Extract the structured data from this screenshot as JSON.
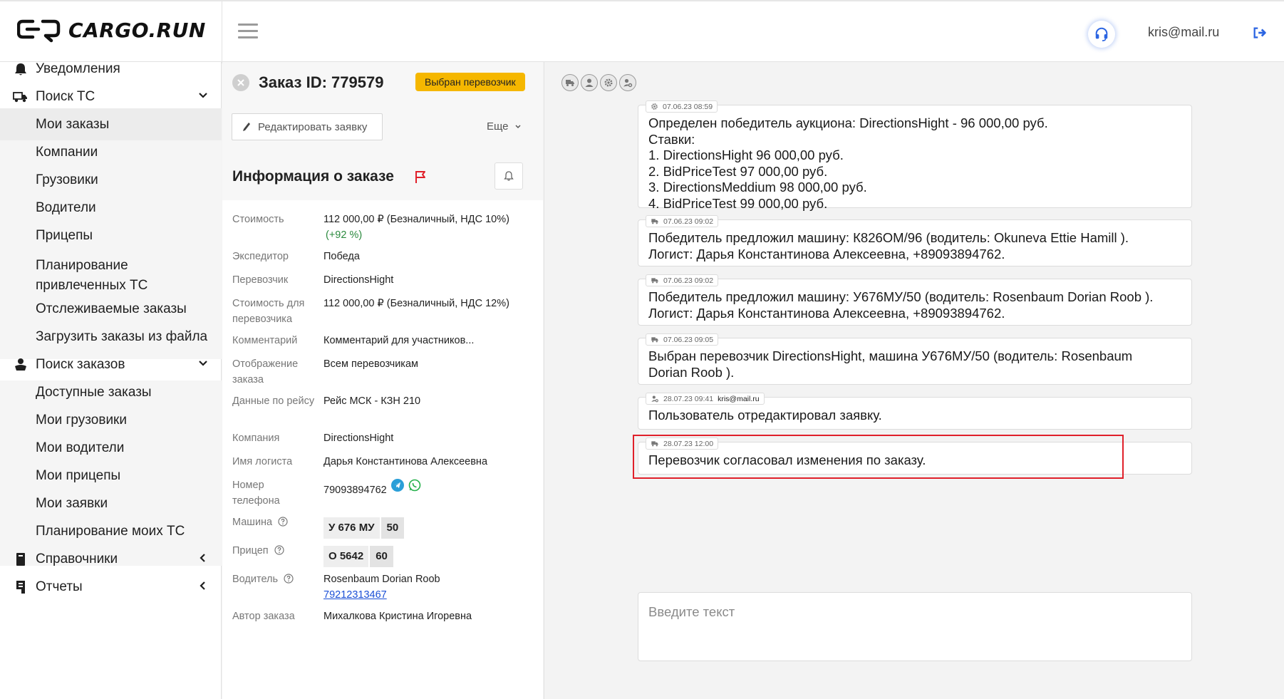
{
  "app": {
    "logo_text": "CARGO.RUN",
    "user_email": "kris@mail.ru"
  },
  "sidebar": {
    "items": [
      {
        "label": "Уведомления",
        "icon": "bell-icon"
      },
      {
        "label": "Поиск ТС",
        "icon": "truck-search-icon",
        "expanded": true
      },
      {
        "label": "Мои заказы",
        "active": true
      },
      {
        "label": "Компании"
      },
      {
        "label": "Грузовики"
      },
      {
        "label": "Водители"
      },
      {
        "label": "Прицепы"
      },
      {
        "label": "Планирование привлеченных ТС"
      },
      {
        "label": "Отслеживаемые заказы"
      },
      {
        "label": "Загрузить заказы из файла"
      },
      {
        "label": "Поиск заказов",
        "icon": "box-hand-icon",
        "expanded": true
      },
      {
        "label": "Доступные заказы"
      },
      {
        "label": "Мои грузовики"
      },
      {
        "label": "Мои водители"
      },
      {
        "label": "Мои прицепы"
      },
      {
        "label": "Мои заявки"
      },
      {
        "label": "Планирование моих ТС"
      },
      {
        "label": "Справочники",
        "icon": "book-icon",
        "expanded": false
      },
      {
        "label": "Отчеты",
        "icon": "report-icon",
        "expanded": false
      }
    ]
  },
  "order": {
    "title": "Заказ ID: 779579",
    "status": "Выбран перевозчик",
    "edit_label": "Редактировать заявку",
    "more_label": "Еще",
    "info_title": "Информация о заказе",
    "fields": {
      "cost_label": "Стоимость",
      "cost_value": "112 000,00 ₽ (Безналичный, НДС 10%)",
      "cost_delta": "(+92 %)",
      "forwarder_label": "Экспедитор",
      "forwarder_value": "Победа",
      "carrier_label": "Перевозчик",
      "carrier_value": "DirectionsHight",
      "carrier_cost_label": "Стоимость для перевозчика",
      "carrier_cost_value": "112 000,00 ₽ (Безналичный, НДС 12%)",
      "comment_label": "Комментарий",
      "comment_value": "Комментарий для участников...",
      "display_label": "Отображение заказа",
      "display_value": "Всем перевозчикам",
      "trip_label": "Данные по рейсу",
      "trip_value": "Рейс МСК - КЗН 210",
      "company_label": "Компания",
      "company_value": "DirectionsHight",
      "logist_label": "Имя логиста",
      "logist_value": "Дарья Константинова Алексеевна",
      "phone_label": "Номер телефона",
      "phone_value": "79093894762",
      "truck_label": "Машина",
      "truck_number": "У 676 МУ",
      "truck_region": "50",
      "trailer_label": "Прицеп",
      "trailer_number": "О 5642",
      "trailer_region": "60",
      "driver_label": "Водитель",
      "driver_name": "Rosenbaum Dorian Roob",
      "driver_phone": "79212313467",
      "author_label": "Автор заказа",
      "author_value": "Михалкова Кристина Игоревна"
    }
  },
  "feed": {
    "messages": [
      {
        "icon": "gear-icon",
        "time": "07.06.23 08:59",
        "author": "",
        "text": "Определен победитель аукциона: DirectionsHight - 96 000,00 руб.\nСтавки:\n1. DirectionsHight 96 000,00 руб.\n2. BidPriceTest 97 000,00 руб.\n3. DirectionsMeddium 98 000,00 руб.\n4. BidPriceTest 99 000,00 руб."
      },
      {
        "icon": "truck-icon",
        "time": "07.06.23 09:02",
        "author": "",
        "text": "Победитель предложил машину: К826ОМ/96 (водитель:  Okuneva Ettie Hamill ).\nЛогист: Дарья Константинова Алексеевна, +89093894762."
      },
      {
        "icon": "truck-icon",
        "time": "07.06.23 09:02",
        "author": "",
        "text": "Победитель предложил машину: У676МУ/50 (водитель:  Rosenbaum Dorian Roob ).\nЛогист: Дарья Константинова Алексеевна, +89093894762."
      },
      {
        "icon": "truck-icon",
        "time": "07.06.23 09:05",
        "author": "",
        "text": "Выбран перевозчик DirectionsHight, машина У676МУ/50 (водитель:  Rosenbaum\nDorian Roob )."
      },
      {
        "icon": "user-gear-icon",
        "time": "28.07.23 09:41",
        "author": "kris@mail.ru",
        "text": "Пользователь отредактировал заявку."
      },
      {
        "icon": "truck-icon",
        "time": "28.07.23 12:00",
        "author": "",
        "text": "Перевозчик согласовал изменения по заказу."
      }
    ],
    "composer_placeholder": "Введите текст"
  },
  "colors": {
    "accent": "#2c65e2",
    "badge": "#f5b700",
    "highlight": "#e0202a",
    "positive": "#2b8a3e"
  }
}
